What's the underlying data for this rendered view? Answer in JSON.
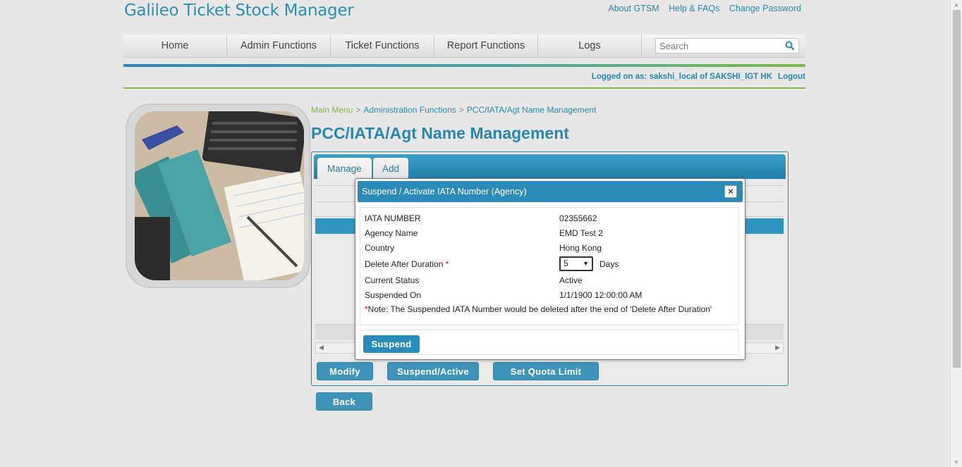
{
  "app": {
    "title": "Galileo Ticket Stock Manager"
  },
  "toplinks": [
    "About GTSM",
    "Help & FAQs",
    "Change Password"
  ],
  "nav": {
    "items": [
      "Home",
      "Admin Functions",
      "Ticket Functions",
      "Report Functions",
      "Logs"
    ],
    "search_placeholder": "Search"
  },
  "session": {
    "logged_text": "Logged on as: sakshi_local of SAKSHI_IGT HK",
    "logout": "Logout"
  },
  "breadcrumb": [
    "Main Menu",
    "Administration Functions",
    "PCC/IATA/Agt Name Management"
  ],
  "breadcrumb_sep": ">",
  "page_title": "PCC/IATA/Agt Name Management",
  "tabs": [
    "Manage",
    "Add"
  ],
  "actions": {
    "modify": "Modify",
    "suspend_active": "Suspend/Active",
    "set_quota": "Set Quota Limit",
    "back": "Back"
  },
  "modal": {
    "title": "Suspend / Activate IATA Number (Agency)",
    "close": "×",
    "fields": [
      {
        "label": "IATA NUMBER",
        "value": "02355662"
      },
      {
        "label": "Agency Name",
        "value": "EMD Test 2"
      },
      {
        "label": "Country",
        "value": "Hong Kong"
      },
      {
        "label": "Delete After Duration",
        "required": "*",
        "value": "5",
        "unit": "Days"
      },
      {
        "label": "Current Status",
        "value": "Active"
      },
      {
        "label": "Suspended On",
        "value": "1/1/1900 12:00:00 AM"
      }
    ],
    "note_star": "*",
    "note": "Note: The Suspended IATA Number would be deleted after the end of 'Delete After Duration'",
    "submit": "Suspend"
  },
  "colors": {
    "brand": "#2a86b0",
    "accent_green": "#7bbc4a",
    "button": "#3f93b9"
  },
  "icons": [
    "search-icon",
    "close-icon",
    "chevron-down-icon",
    "scroll-left-icon",
    "scroll-right-icon"
  ]
}
